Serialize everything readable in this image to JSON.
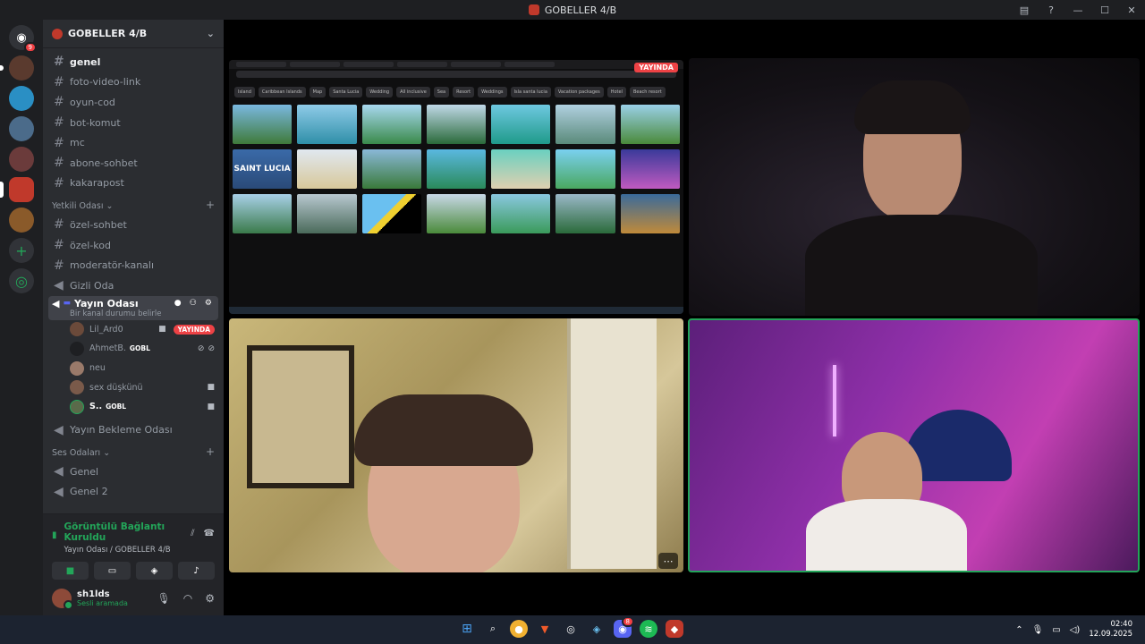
{
  "window": {
    "title": "GOBELLER 4/B"
  },
  "servers": {
    "discord_badge": "9"
  },
  "sidebar": {
    "guild_name": "GOBELLER 4/B",
    "channels": [
      {
        "label": "genel",
        "state": "unread"
      },
      {
        "label": "foto-video-link",
        "state": "normal"
      },
      {
        "label": "oyun-cod",
        "state": "normal"
      },
      {
        "label": "bot-komut",
        "state": "normal"
      },
      {
        "label": "mc",
        "state": "normal"
      },
      {
        "label": "abone-sohbet",
        "state": "normal"
      },
      {
        "label": "kakarapost",
        "state": "normal"
      }
    ],
    "category_yetkili": "Yetkili Odası",
    "yetkili_channels": [
      {
        "label": "özel-sohbet"
      },
      {
        "label": "özel-kod"
      },
      {
        "label": "moderatör-kanalı"
      }
    ],
    "gizli_oda": "Gizli Oda",
    "active_voice": {
      "name": "Yayın Odası",
      "status": "Bir kanal durumu belirle"
    },
    "members": [
      {
        "name": "Lil_Ard0",
        "live": "YAYINDA"
      },
      {
        "name": "AhmetB.",
        "tag": "GOBL"
      },
      {
        "name": "neu"
      },
      {
        "name": "sex düşkünü"
      },
      {
        "name": "S..",
        "tag": "GOBL"
      }
    ],
    "bekleme_odasi": "Yayın Bekleme Odası",
    "category_ses": "Ses Odaları",
    "ses_channels": [
      {
        "label": "Genel"
      },
      {
        "label": "Genel 2"
      }
    ]
  },
  "voice_panel": {
    "title": "Görüntülü Bağlantı Kuruldu",
    "subtitle": "Yayın Odası / GOBELLER 4/B"
  },
  "user": {
    "name": "sh1lds",
    "status": "Sesli aramada"
  },
  "stage": {
    "live_label": "YAYINDA",
    "search_chips": [
      "Island",
      "Caribbean Islands",
      "Map",
      "Santa Lucia",
      "Wedding",
      "All inclusive",
      "Sea",
      "Resort",
      "Weddings",
      "Isla santa lucia",
      "Vacation packages",
      "Hotel",
      "Beach resort"
    ],
    "grid_caption": "SAINT LUCIA"
  },
  "taskbar": {
    "discord_badge": "8",
    "time": "02:40",
    "date": "12.09.2025"
  },
  "colors": {
    "accent_green": "#23a559",
    "live_red": "#ed4245",
    "sidebar_bg": "#2b2d31"
  }
}
